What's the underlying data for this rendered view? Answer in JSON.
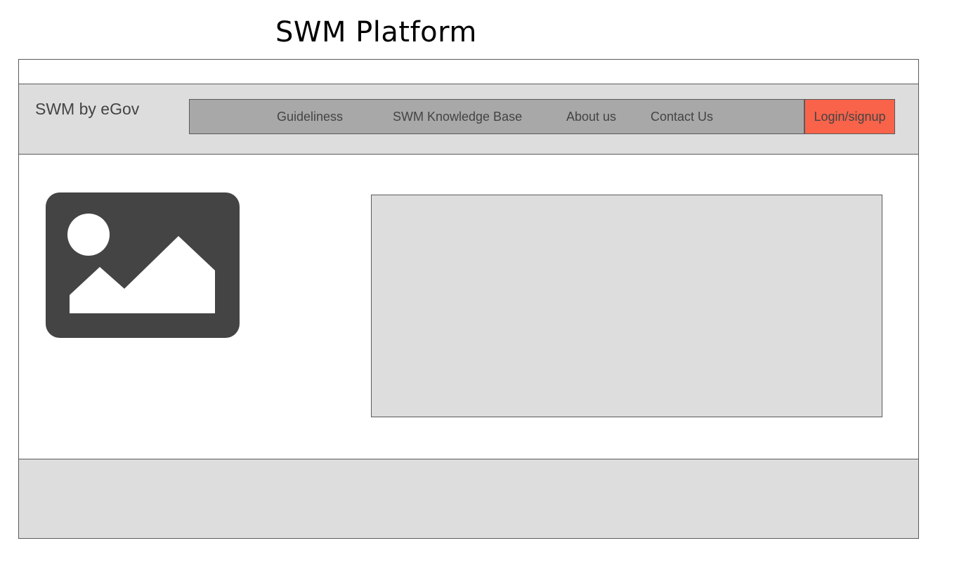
{
  "page": {
    "title": "SWM Platform"
  },
  "header": {
    "brand": "SWM by eGov",
    "nav": [
      {
        "label": "Guideliness"
      },
      {
        "label": "SWM Knowledge Base"
      },
      {
        "label": "About us"
      },
      {
        "label": "Contact Us"
      }
    ],
    "login_label": "Login/signup"
  },
  "main": {
    "image_icon": "image-icon"
  },
  "colors": {
    "header_bg": "#dddddd",
    "navbar_bg": "#a8a8a8",
    "login_bg": "#f8634a",
    "icon_fill": "#444444",
    "panel_bg": "#dddddd"
  }
}
